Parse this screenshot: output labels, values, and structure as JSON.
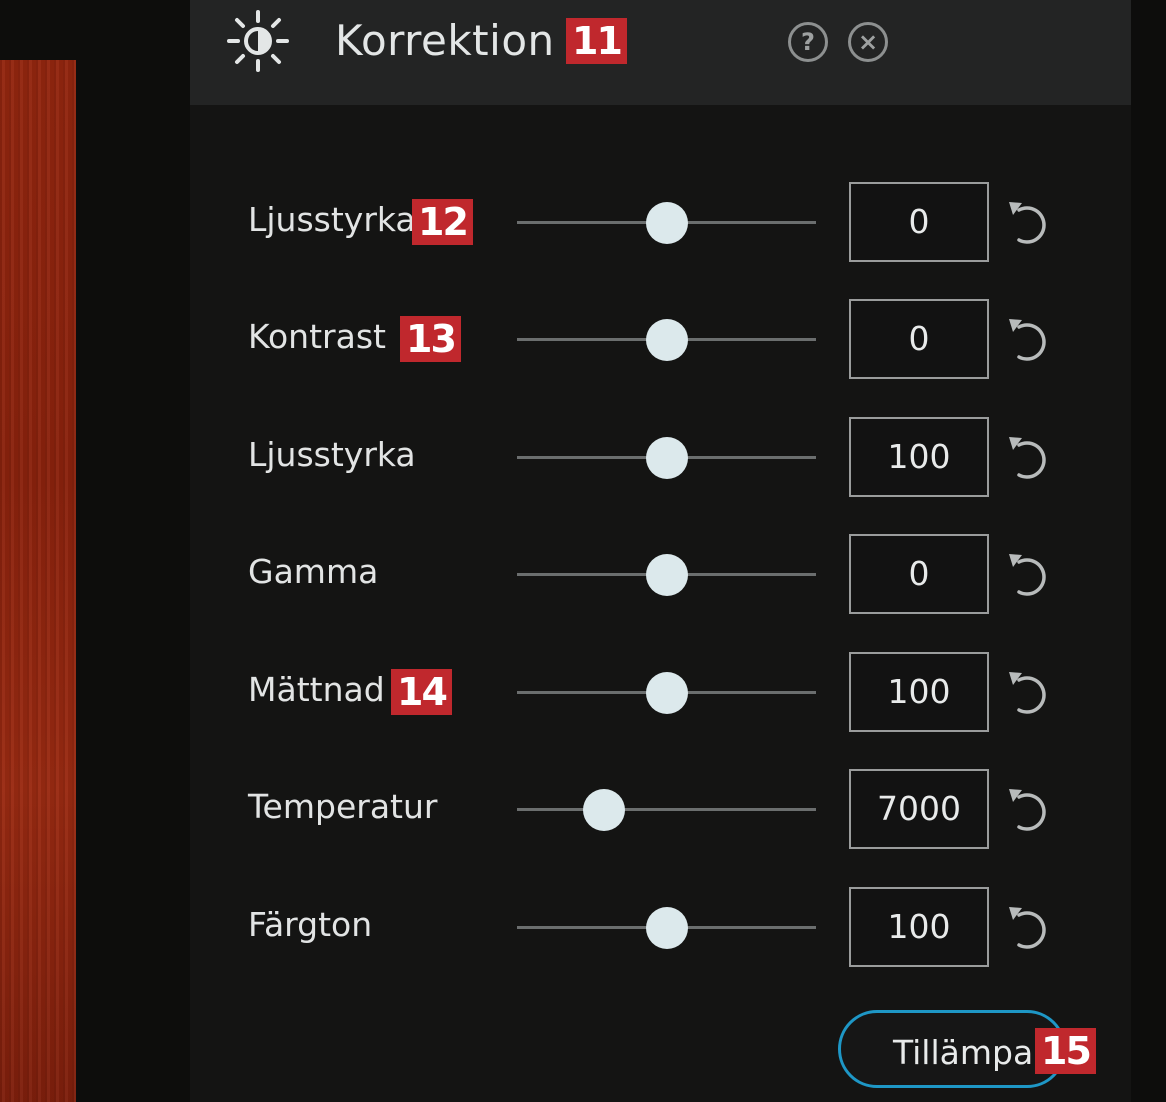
{
  "panel": {
    "title": "Korrektion",
    "title_badge": "11",
    "help_icon": "?",
    "close_icon": "×"
  },
  "rows": [
    {
      "label": "Ljusstyrka",
      "badge": "12",
      "value": "0",
      "slider_fraction": 0.5
    },
    {
      "label": "Kontrast",
      "badge": "13",
      "value": "0",
      "slider_fraction": 0.5
    },
    {
      "label": "Ljusstyrka",
      "badge": "",
      "value": "100",
      "slider_fraction": 0.5
    },
    {
      "label": "Gamma",
      "badge": "",
      "value": "0",
      "slider_fraction": 0.5
    },
    {
      "label": "Mättnad",
      "badge": "14",
      "value": "100",
      "slider_fraction": 0.5
    },
    {
      "label": "Temperatur",
      "badge": "",
      "value": "7000",
      "slider_fraction": 0.29
    },
    {
      "label": "Färgton",
      "badge": "",
      "value": "100",
      "slider_fraction": 0.5
    }
  ],
  "apply": {
    "label": "Tillämpa",
    "badge": "15"
  },
  "colors": {
    "badge": "#c0282d",
    "apply_border": "#1e97c6",
    "thumb": "#dce9ec"
  },
  "icons": {
    "title": "sun-icon",
    "help": "help-icon",
    "close": "close-icon",
    "reset": "reset-icon"
  }
}
